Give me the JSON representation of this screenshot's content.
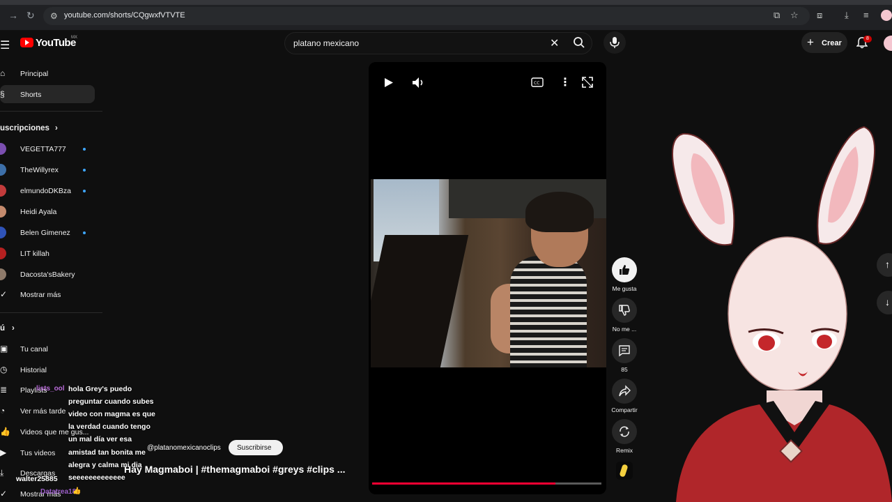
{
  "browser": {
    "url": "youtube.com/shorts/CQgwxfVTVTE"
  },
  "header": {
    "logo_text": "YouTube",
    "logo_region": "MX",
    "search_value": "platano mexicano",
    "create_label": "Crear",
    "notifications_count": "8"
  },
  "sidebar": {
    "main": [
      {
        "label": "Principal",
        "icon": "home-icon"
      },
      {
        "label": "Shorts",
        "icon": "shorts-icon"
      }
    ],
    "subscriptions_heading": "uscripciones",
    "subscriptions": [
      {
        "label": "VEGETTA777",
        "color": "#7b4fb0",
        "live": true
      },
      {
        "label": "TheWillyrex",
        "color": "#3d6fa8",
        "live": true
      },
      {
        "label": "elmundoDKBza",
        "color": "#c23b3b",
        "live": true
      },
      {
        "label": "Heidi Ayala",
        "color": "#c48a6d",
        "live": false
      },
      {
        "label": "Belen Gimenez",
        "color": "#2f53b8",
        "live": true
      },
      {
        "label": "LIT killah",
        "color": "#b52020",
        "live": false
      },
      {
        "label": "Dacosta'sBakery",
        "color": "#8e7a6a",
        "live": false
      }
    ],
    "show_more": "Mostrar más",
    "you_heading": "ú",
    "you_items": [
      {
        "label": "Tu canal",
        "icon": "channel-icon"
      },
      {
        "label": "Historial",
        "icon": "history-icon"
      },
      {
        "label": "Playlists",
        "icon": "playlist-icon"
      },
      {
        "label": "Ver más tarde",
        "icon": "watch-later-icon"
      },
      {
        "label": "Videos que me gus...",
        "icon": "like-icon"
      },
      {
        "label": "Tus videos",
        "icon": "video-icon"
      },
      {
        "label": "Descargas",
        "icon": "download-icon"
      },
      {
        "label": "Mostrar más",
        "icon": "chevron-down-icon"
      }
    ]
  },
  "short": {
    "channel": "@platanomexicanoclips",
    "subscribe_label": "Suscribirse",
    "title": "Hay Magmaboi | #themagmaboi #greys #clips ...",
    "progress": 0.8,
    "actions": {
      "like_label": "Me gusta",
      "dislike_label": "No me ...",
      "comments_count": "85",
      "share_label": "Compartir",
      "remix_label": "Remix"
    }
  },
  "chat": {
    "overlay_name": "lists_ool",
    "message_lines": [
      "hola Grey's puedo",
      "preguntar cuando subes",
      "video con magma es que",
      "la verdad cuando tengo",
      "un mal día ver esa",
      "amistad tan bonita me",
      "alegra y calma mi dia",
      "seeeeeeeeeeeee"
    ],
    "username": "walter25885",
    "username2": "Datatrea18"
  }
}
